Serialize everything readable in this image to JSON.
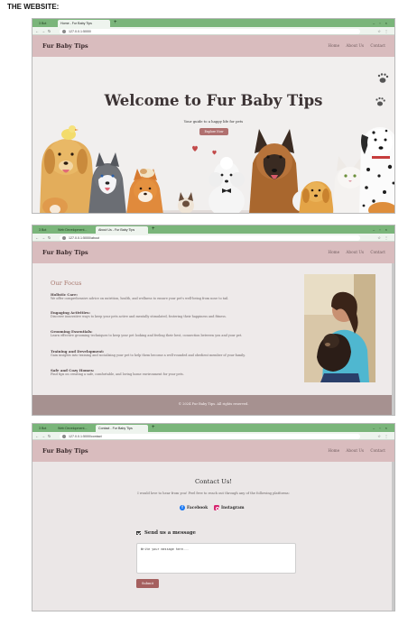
{
  "heading": "THE WEBSITE:",
  "brand": "Fur Baby Tips",
  "nav_links": [
    "Home",
    "About Us",
    "Contact"
  ],
  "shot1": {
    "tabs": [
      "3 Bot",
      "Home - Fur Baby Tips"
    ],
    "url": "127.0.0.1:5000/",
    "hero_title": "Welcome to Fur Baby Tips",
    "hero_subtitle": "Your guide to a happy life for pets",
    "hero_button": "Explore Now"
  },
  "shot2": {
    "tabs": [
      "3 Bot",
      "Web Development...",
      "About Us - Fur Baby Tips"
    ],
    "url": "127.0.0.1:5000/about",
    "focus_title": "Our Focus",
    "items": [
      {
        "heading": "Holistic Care:",
        "text": "We offer comprehensive advice on nutrition, health, and wellness to ensure your pet's well-being from nose to tail."
      },
      {
        "heading": "Engaging Activities:",
        "text": "Discover innovative ways to keep your pets active and mentally stimulated, fostering their happiness and fitness."
      },
      {
        "heading": "Grooming Essentials:",
        "text": "Learn effective grooming techniques to keep your pet looking and feeling their best, connection between you and your pet."
      },
      {
        "heading": "Training and Development:",
        "text": "Gain insights into training and socializing your pet to help them become a well-rounded and obedient member of your family."
      },
      {
        "heading": "Safe and Cozy Homes:",
        "text": "Find tips on creating a safe, comfortable, and loving home environment for your pets."
      }
    ],
    "footer": "© 2024 Fur Baby Tips. All rights reserved."
  },
  "shot3": {
    "tabs": [
      "3 Bot",
      "Web Development...",
      "Contact - Fur Baby Tips"
    ],
    "url": "127.0.0.1:5000/contact",
    "title": "Contact Us!",
    "subtitle": "I would love to hear from you! Feel free to reach out through any of the following platforms:",
    "facebook": "Facebook",
    "instagram": "Instagram",
    "message_title": "Send us a message",
    "placeholder": "Write your message here...",
    "submit": "Submit"
  },
  "colors": {
    "navbar": "#d9bcbe",
    "browser_green": "#7ab57a",
    "button": "#b0706f",
    "footer": "#a69190",
    "focus_title": "#a8776d"
  },
  "icons": [
    "back-arrow-icon",
    "forward-arrow-icon",
    "reload-icon",
    "star-icon",
    "menu-icon",
    "facebook-icon",
    "instagram-icon",
    "envelope-icon",
    "paw-icon"
  ]
}
